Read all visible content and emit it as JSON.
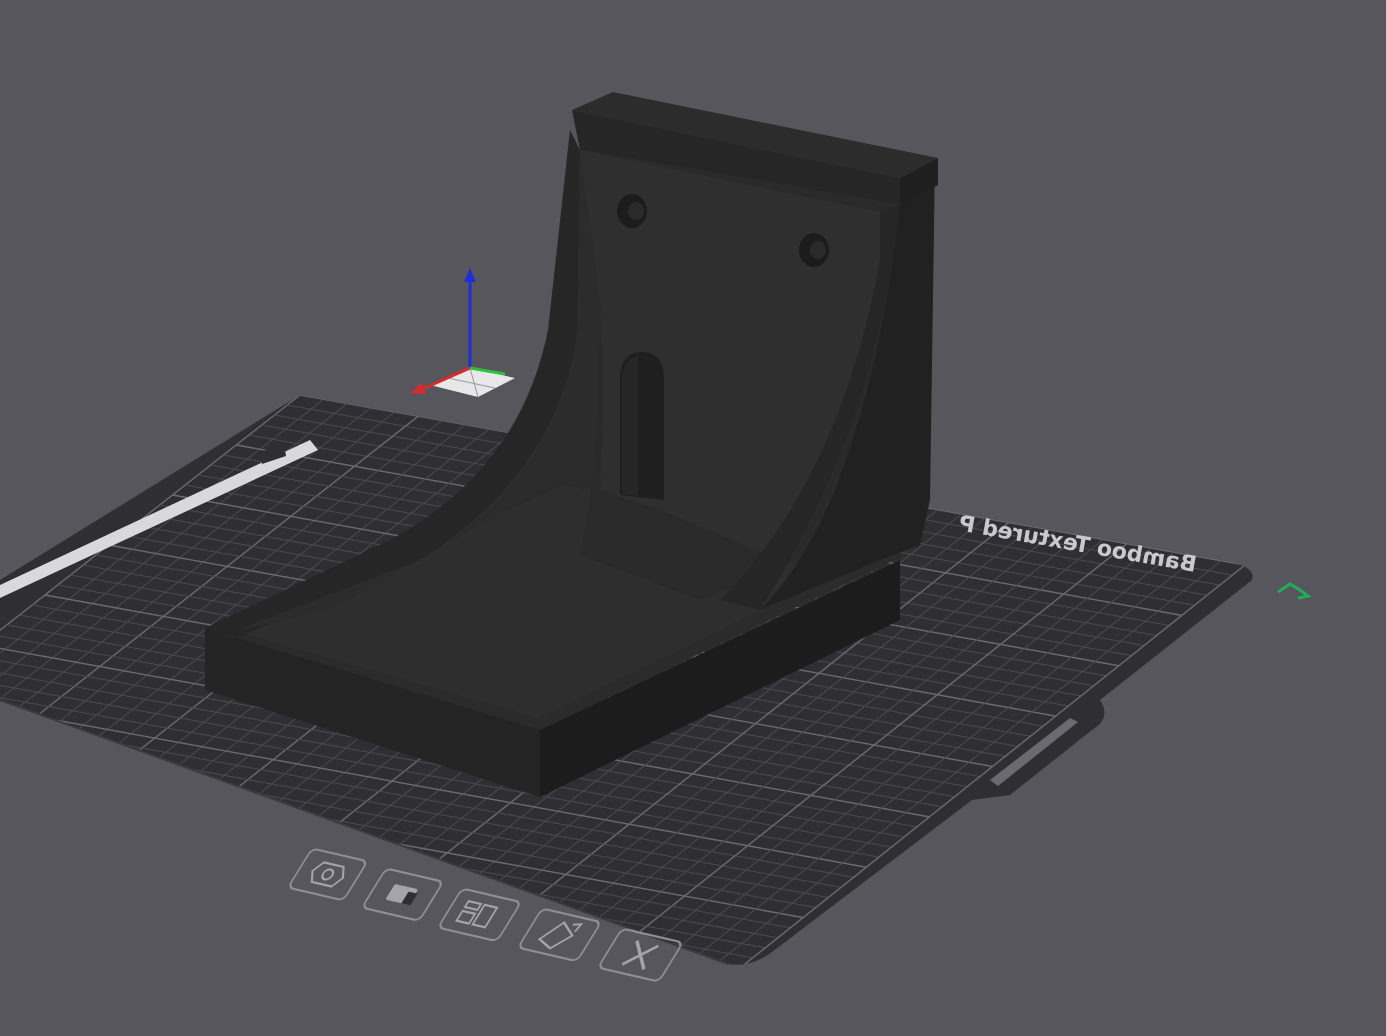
{
  "app": {
    "view": "3d-prepare-view"
  },
  "plate": {
    "name_text": "Bamboo Textured P",
    "label_strip_text": "",
    "colors": {
      "background": "#57565c",
      "plate": "#2f2f33",
      "grid_minor": "#4a4a50",
      "grid_major": "#6a6a70",
      "model_dark": "#1e1e1f",
      "model_mid": "#2a2a2b",
      "model_light": "#333334",
      "axis_x": "#d62b2b",
      "axis_y": "#2fbf3a",
      "axis_z": "#1d2fd4",
      "accent": "#1fae55"
    }
  },
  "plate_toolbar": {
    "buttons": [
      {
        "name": "plate-settings-icon"
      },
      {
        "name": "plate-lock-icon"
      },
      {
        "name": "arrange-icon"
      },
      {
        "name": "auto-orient-icon"
      },
      {
        "name": "delete-plate-icon"
      }
    ]
  }
}
